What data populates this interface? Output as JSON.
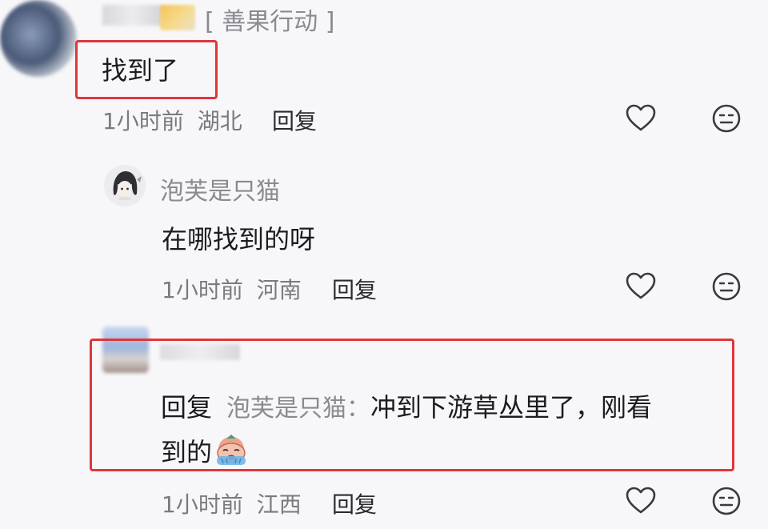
{
  "comment1": {
    "tag": "[ 善果行动 ]",
    "text": "找到了",
    "time": "1小时前",
    "location": "湖北",
    "reply_label": "回复"
  },
  "reply1": {
    "username": "泡芙是只猫",
    "text": "在哪找到的呀",
    "time": "1小时前",
    "location": "河南",
    "reply_label": "回复"
  },
  "reply2": {
    "prefix": "回复",
    "reply_to": "泡芙是只猫：",
    "text_line1": "冲到下游草丛里了，刚看",
    "text_line2": "到的",
    "time": "1小时前",
    "location": "江西",
    "reply_label": "回复"
  },
  "icons": [
    "like-heart-icon",
    "dislike-face-icon",
    "crying-emoji-icon"
  ],
  "colors": {
    "highlight_box": "#e0363a",
    "meta_text": "#7a7a80",
    "username": "#8a8a90"
  }
}
